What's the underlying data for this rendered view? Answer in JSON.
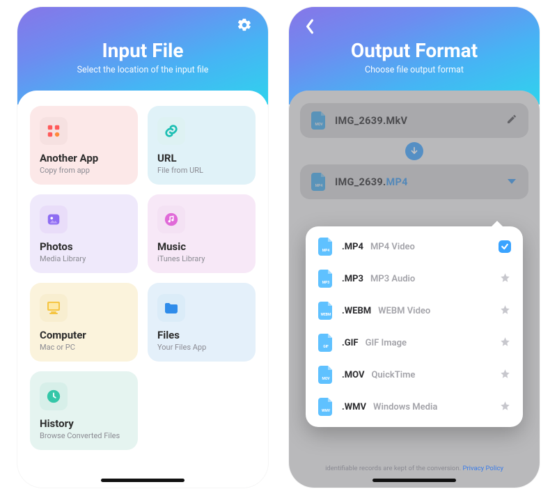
{
  "left": {
    "title": "Input File",
    "subtitle": "Select the location of the input file",
    "tiles": [
      {
        "title": "Another App",
        "subtitle": "Copy from app"
      },
      {
        "title": "URL",
        "subtitle": "File from URL"
      },
      {
        "title": "Photos",
        "subtitle": "Media Library"
      },
      {
        "title": "Music",
        "subtitle": "iTunes Library"
      },
      {
        "title": "Computer",
        "subtitle": "Mac or PC"
      },
      {
        "title": "Files",
        "subtitle": "Your Files App"
      },
      {
        "title": "History",
        "subtitle": "Browse Converted Files"
      }
    ]
  },
  "right": {
    "title": "Output Format",
    "subtitle": "Choose file output format",
    "input_file": {
      "badge": "MOV",
      "name": "IMG_2639.MkV"
    },
    "output_file": {
      "badge": "MP4",
      "name_base": "IMG_2639.",
      "name_ext": "MP4"
    },
    "options": [
      {
        "badge": "MP4",
        "ext": ".MP4",
        "desc": "MP4 Video",
        "selected": true
      },
      {
        "badge": "MP3",
        "ext": ".MP3",
        "desc": "MP3 Audio",
        "selected": false
      },
      {
        "badge": "WEBM",
        "ext": ".WEBM",
        "desc": "WEBM Video",
        "selected": false
      },
      {
        "badge": "GIF",
        "ext": ".GIF",
        "desc": "GIF Image",
        "selected": false
      },
      {
        "badge": "MOV",
        "ext": ".MOV",
        "desc": "QuickTime",
        "selected": false
      },
      {
        "badge": "WMV",
        "ext": ".WMV",
        "desc": "Windows Media",
        "selected": false
      }
    ],
    "footnote_text": "identifiable records are kept of the conversion. ",
    "footnote_link": "Privacy Policy"
  },
  "colors": {
    "accent": "#3aa3ff"
  }
}
